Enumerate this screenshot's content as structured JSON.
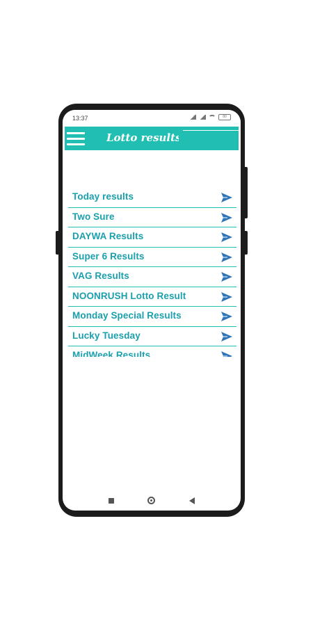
{
  "status_bar": {
    "time": "13:37",
    "battery": "80"
  },
  "app_bar": {
    "title": "Lotto results"
  },
  "colors": {
    "accent": "#21bfb3",
    "text": "#1a9fad",
    "arrow": "#2f76b8"
  },
  "menu": [
    {
      "label": "Today results"
    },
    {
      "label": "Two Sure"
    },
    {
      "label": "DAYWA Results"
    },
    {
      "label": "Super 6 Results"
    },
    {
      "label": "VAG Results"
    },
    {
      "label": "NOONRUSH Lotto Result"
    },
    {
      "label": "Monday Special Results"
    },
    {
      "label": "Lucky Tuesday"
    },
    {
      "label": "MidWeek Results"
    }
  ],
  "icons": {
    "menu": "hamburger-icon",
    "item_arrow": "send-arrow-icon"
  }
}
